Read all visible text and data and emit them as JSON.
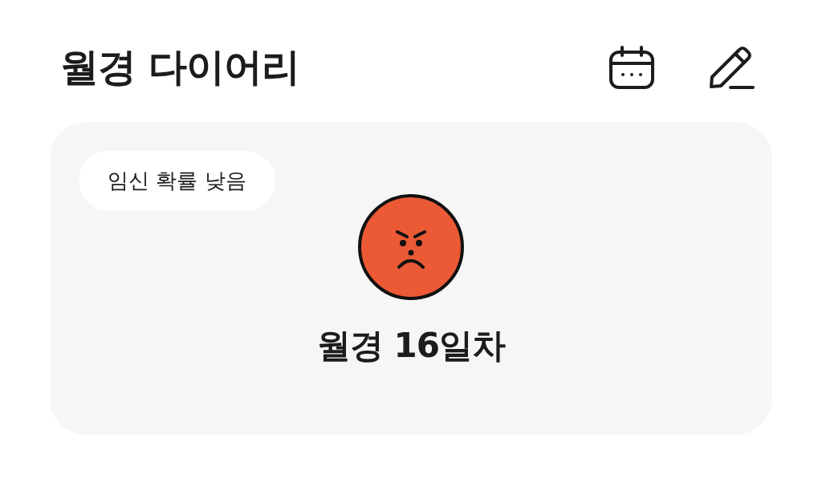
{
  "header": {
    "title": "월경 다이어리"
  },
  "card": {
    "badge": "임신 확률 낮음",
    "status": "월경 16일차"
  }
}
